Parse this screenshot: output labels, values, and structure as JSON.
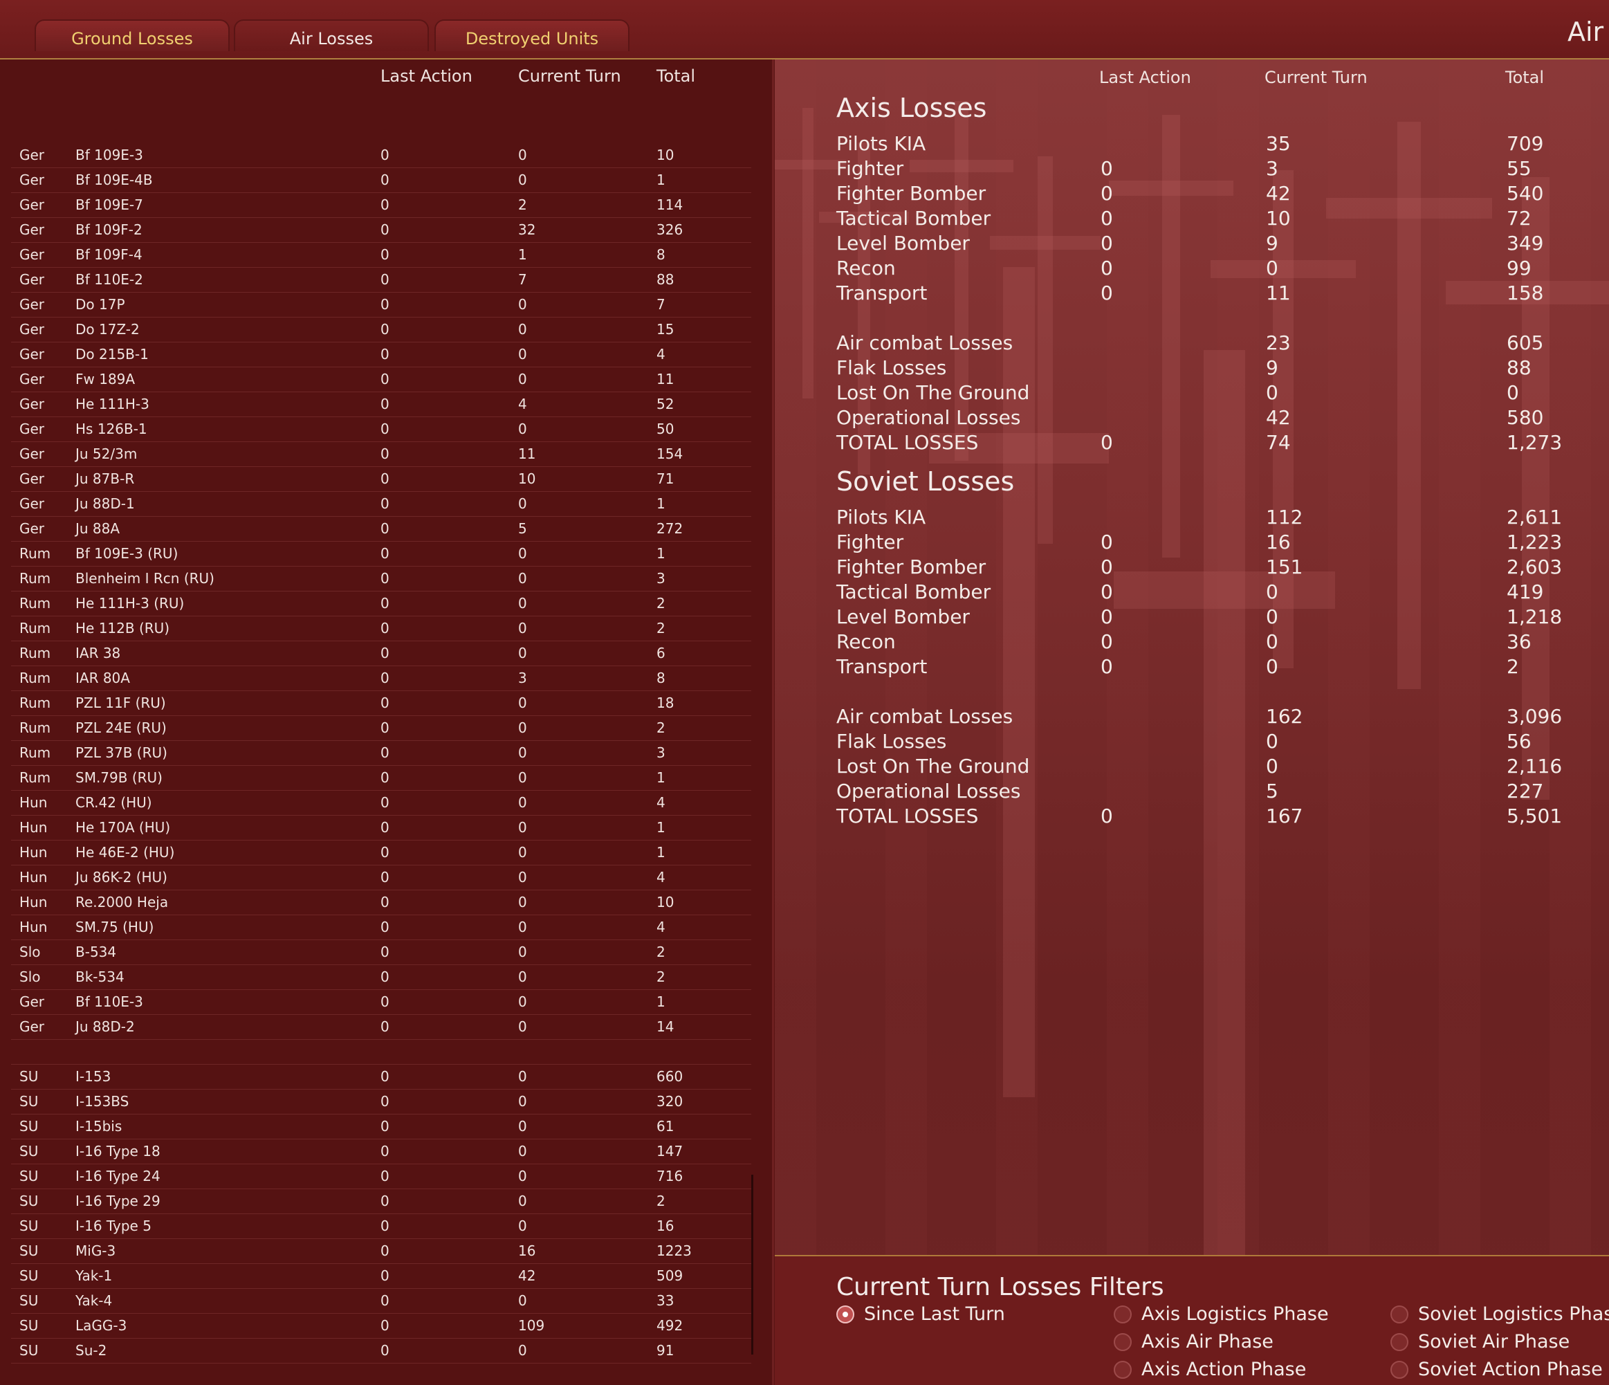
{
  "tabs": {
    "ground": "Ground Losses",
    "air": "Air Losses",
    "destroyed": "Destroyed Units"
  },
  "screen_title": "Air Losses",
  "left_headers": {
    "last_action": "Last Action",
    "current_turn": "Current Turn",
    "total": "Total"
  },
  "rows": [
    [
      "Ger",
      "Bf 109E-3",
      "0",
      "0",
      "10"
    ],
    [
      "Ger",
      "Bf 109E-4B",
      "0",
      "0",
      "1"
    ],
    [
      "Ger",
      "Bf 109E-7",
      "0",
      "2",
      "114"
    ],
    [
      "Ger",
      "Bf 109F-2",
      "0",
      "32",
      "326"
    ],
    [
      "Ger",
      "Bf 109F-4",
      "0",
      "1",
      "8"
    ],
    [
      "Ger",
      "Bf 110E-2",
      "0",
      "7",
      "88"
    ],
    [
      "Ger",
      "Do 17P",
      "0",
      "0",
      "7"
    ],
    [
      "Ger",
      "Do 17Z-2",
      "0",
      "0",
      "15"
    ],
    [
      "Ger",
      "Do 215B-1",
      "0",
      "0",
      "4"
    ],
    [
      "Ger",
      "Fw 189A",
      "0",
      "0",
      "11"
    ],
    [
      "Ger",
      "He 111H-3",
      "0",
      "4",
      "52"
    ],
    [
      "Ger",
      "Hs 126B-1",
      "0",
      "0",
      "50"
    ],
    [
      "Ger",
      "Ju 52/3m",
      "0",
      "11",
      "154"
    ],
    [
      "Ger",
      "Ju 87B-R",
      "0",
      "10",
      "71"
    ],
    [
      "Ger",
      "Ju 88D-1",
      "0",
      "0",
      "1"
    ],
    [
      "Ger",
      "Ju 88A",
      "0",
      "5",
      "272"
    ],
    [
      "Rum",
      "Bf 109E-3 (RU)",
      "0",
      "0",
      "1"
    ],
    [
      "Rum",
      "Blenheim I Rcn (RU)",
      "0",
      "0",
      "3"
    ],
    [
      "Rum",
      "He 111H-3 (RU)",
      "0",
      "0",
      "2"
    ],
    [
      "Rum",
      "He 112B (RU)",
      "0",
      "0",
      "2"
    ],
    [
      "Rum",
      "IAR 38",
      "0",
      "0",
      "6"
    ],
    [
      "Rum",
      "IAR 80A",
      "0",
      "3",
      "8"
    ],
    [
      "Rum",
      "PZL 11F (RU)",
      "0",
      "0",
      "18"
    ],
    [
      "Rum",
      "PZL 24E (RU)",
      "0",
      "0",
      "2"
    ],
    [
      "Rum",
      "PZL 37B (RU)",
      "0",
      "0",
      "3"
    ],
    [
      "Rum",
      "SM.79B (RU)",
      "0",
      "0",
      "1"
    ],
    [
      "Hun",
      "CR.42 (HU)",
      "0",
      "0",
      "4"
    ],
    [
      "Hun",
      "He 170A (HU)",
      "0",
      "0",
      "1"
    ],
    [
      "Hun",
      "He 46E-2 (HU)",
      "0",
      "0",
      "1"
    ],
    [
      "Hun",
      "Ju 86K-2 (HU)",
      "0",
      "0",
      "4"
    ],
    [
      "Hun",
      "Re.2000 Heja",
      "0",
      "0",
      "10"
    ],
    [
      "Hun",
      "SM.75 (HU)",
      "0",
      "0",
      "4"
    ],
    [
      "Slo",
      "B-534",
      "0",
      "0",
      "2"
    ],
    [
      "Slo",
      "Bk-534",
      "0",
      "0",
      "2"
    ],
    [
      "Ger",
      "Bf 110E-3",
      "0",
      "0",
      "1"
    ],
    [
      "Ger",
      "Ju 88D-2",
      "0",
      "0",
      "14"
    ],
    [
      "",
      "",
      "",
      "",
      ""
    ],
    [
      "SU",
      "I-153",
      "0",
      "0",
      "660"
    ],
    [
      "SU",
      "I-153BS",
      "0",
      "0",
      "320"
    ],
    [
      "SU",
      "I-15bis",
      "0",
      "0",
      "61"
    ],
    [
      "SU",
      "I-16 Type 18",
      "0",
      "0",
      "147"
    ],
    [
      "SU",
      "I-16 Type 24",
      "0",
      "0",
      "716"
    ],
    [
      "SU",
      "I-16 Type 29",
      "0",
      "0",
      "2"
    ],
    [
      "SU",
      "I-16 Type 5",
      "0",
      "0",
      "16"
    ],
    [
      "SU",
      "MiG-3",
      "0",
      "16",
      "1223"
    ],
    [
      "SU",
      "Yak-1",
      "0",
      "42",
      "509"
    ],
    [
      "SU",
      "Yak-4",
      "0",
      "0",
      "33"
    ],
    [
      "SU",
      "LaGG-3",
      "0",
      "109",
      "492"
    ],
    [
      "SU",
      "Su-2",
      "0",
      "0",
      "91"
    ]
  ],
  "right_headers": {
    "last_action": "Last Action",
    "current_turn": "Current Turn",
    "total": "Total"
  },
  "sections": [
    {
      "title": "Axis Losses",
      "lines": [
        [
          "Pilots KIA",
          "",
          "35",
          "709"
        ],
        [
          "Fighter",
          "0",
          "3",
          "55"
        ],
        [
          "Fighter Bomber",
          "0",
          "42",
          "540"
        ],
        [
          "Tactical Bomber",
          "0",
          "10",
          "72"
        ],
        [
          "Level Bomber",
          "0",
          "9",
          "349"
        ],
        [
          "Recon",
          "0",
          "0",
          "99"
        ],
        [
          "Transport",
          "0",
          "11",
          "158"
        ],
        [
          "",
          "",
          "",
          ""
        ],
        [
          "Air combat Losses",
          "",
          "23",
          "605"
        ],
        [
          "Flak Losses",
          "",
          "9",
          "88"
        ],
        [
          "Lost On The Ground",
          "",
          "0",
          "0"
        ],
        [
          "Operational Losses",
          "",
          "42",
          "580"
        ],
        [
          "TOTAL LOSSES",
          "0",
          "74",
          "1,273"
        ]
      ]
    },
    {
      "title": "Soviet Losses",
      "lines": [
        [
          "Pilots KIA",
          "",
          "112",
          "2,611"
        ],
        [
          "Fighter",
          "0",
          "16",
          "1,223"
        ],
        [
          "Fighter Bomber",
          "0",
          "151",
          "2,603"
        ],
        [
          "Tactical Bomber",
          "0",
          "0",
          "419"
        ],
        [
          "Level Bomber",
          "0",
          "0",
          "1,218"
        ],
        [
          "Recon",
          "0",
          "0",
          "36"
        ],
        [
          "Transport",
          "0",
          "0",
          "2"
        ],
        [
          "",
          "",
          "",
          ""
        ],
        [
          "Air combat Losses",
          "",
          "162",
          "3,096"
        ],
        [
          "Flak Losses",
          "",
          "0",
          "56"
        ],
        [
          "Lost On The Ground",
          "",
          "0",
          "2,116"
        ],
        [
          "Operational Losses",
          "",
          "5",
          "227"
        ],
        [
          "TOTAL LOSSES",
          "0",
          "167",
          "5,501"
        ]
      ]
    }
  ],
  "filters": {
    "title": "Current Turn Losses Filters",
    "options": [
      {
        "label": "Since Last Turn",
        "selected": true
      },
      {
        "label": "Axis Logistics Phase",
        "selected": false
      },
      {
        "label": "Axis Air Phase",
        "selected": false
      },
      {
        "label": "Axis Action Phase",
        "selected": false
      },
      {
        "label": "Soviet Logistics Phase",
        "selected": false
      },
      {
        "label": "Soviet Air Phase",
        "selected": false
      },
      {
        "label": "Soviet Action Phase",
        "selected": false
      }
    ]
  }
}
